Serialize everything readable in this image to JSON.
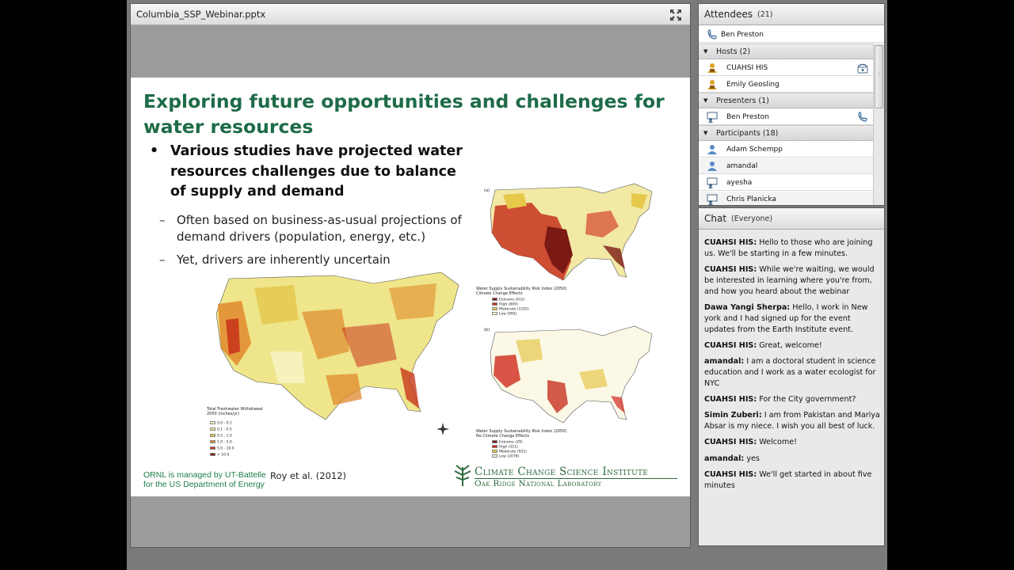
{
  "share": {
    "filename": "Columbia_SSP_Webinar.pptx",
    "fullscreen_icon": "fullscreen-arrows-icon"
  },
  "slide": {
    "title": "Exploring future opportunities and challenges for water resources",
    "bullet_main": "Various studies have projected water resources challenges due to balance of supply and demand",
    "sub_bullets": [
      "Often based on business-as-usual projections of demand drivers (population, energy, etc.)",
      "Yet, drivers are inherently uncertain"
    ],
    "footer_note_line1": "ORNL is managed by UT-Battelle",
    "footer_note_line2": "for the US Department of Energy",
    "citation": "Roy et al. (2012)",
    "logo_line1": "Climate Change Science Institute",
    "logo_line2": "Oak Ridge National Laboratory",
    "map_main": {
      "legend_title": "Total Freshwater Withdrawal",
      "legend_subtitle": "2050 (inches/yr)",
      "legend_items": [
        "0.0 - 0.1",
        "0.1 - 0.5",
        "0.5 - 1.0",
        "1.0 - 5.0",
        "5.0 - 10.0",
        "> 10.0"
      ],
      "legend_colors": [
        "#f7f3c0",
        "#efe58a",
        "#e2c74a",
        "#e08a2c",
        "#c8371c",
        "#7a1a12"
      ]
    },
    "map_a": {
      "label": "(a)",
      "legend_title": "Water Supply Sustainability Risk Index (2050)",
      "legend_subtitle": "Climate Change Effects",
      "legend_items": [
        "Extreme (412)",
        "High (600)",
        "Moderate (1102)",
        "Low (995)"
      ],
      "legend_colors": [
        "#7a1a12",
        "#d12a1c",
        "#e6c84a",
        "#fbf6d8"
      ]
    },
    "map_b": {
      "label": "(b)",
      "legend_title": "Water Supply Sustainability Risk Index (2050)",
      "legend_subtitle": "No Climate Change Effects",
      "legend_items": [
        "Extreme (29)",
        "High (311)",
        "Moderate (921)",
        "Low (2078)"
      ],
      "legend_colors": [
        "#7a1a12",
        "#d12a1c",
        "#e6c84a",
        "#fbf6d8"
      ]
    }
  },
  "attendees": {
    "title": "Attendees",
    "count": "(21)",
    "me": "Ben Preston",
    "groups": [
      {
        "label": "Hosts (2)",
        "members": [
          "CUAHSI HIS",
          "Emily Geosling"
        ]
      },
      {
        "label": "Presenters (1)",
        "members": [
          "Ben Preston"
        ]
      },
      {
        "label": "Participants (18)",
        "members": [
          "Adam Schempp",
          "amandal",
          "ayesha",
          "Chris Planicka"
        ]
      }
    ]
  },
  "chat": {
    "title": "Chat",
    "scope": "(Everyone)",
    "messages": [
      {
        "sender": "CUAHSI HIS:",
        "text": "Hello to those who are joining us. We'll be starting in a few minutes."
      },
      {
        "sender": "CUAHSI HIS:",
        "text": "While we're waiting, we would be interested in learning where you're from, and how you heard about the webinar"
      },
      {
        "sender": "Dawa Yangi Sherpa:",
        "text": "Hello, I work in New york and I had signed up for the event updates from the Earth Institute event."
      },
      {
        "sender": "CUAHSI HIS:",
        "text": "Great, welcome!"
      },
      {
        "sender": "amandal:",
        "text": "I am a doctoral student in science education and I work as a water ecologist for NYC"
      },
      {
        "sender": "CUAHSI HIS:",
        "text": "For the City government?"
      },
      {
        "sender": "Simin Zuberi:",
        "text": " I am from Pakistan and Mariya Absar is my niece. I wish you all best of luck."
      },
      {
        "sender": "CUAHSI HIS:",
        "text": "Welcome!"
      },
      {
        "sender": "amandal:",
        "text": "yes"
      },
      {
        "sender": "CUAHSI HIS:",
        "text": "We'll get started in about five minutes"
      }
    ]
  }
}
